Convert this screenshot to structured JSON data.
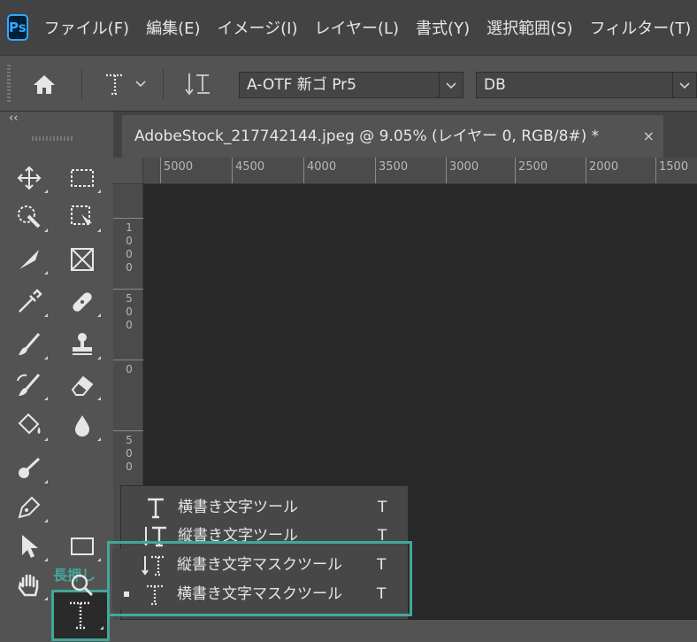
{
  "app": {
    "logo_text": "Ps"
  },
  "menu": [
    "ファイル(F)",
    "編集(E)",
    "イメージ(I)",
    "レイヤー(L)",
    "書式(Y)",
    "選択範囲(S)",
    "フィルター(T)"
  ],
  "options_bar": {
    "font_family": "A-OTF 新ゴ Pr5",
    "font_style": "DB"
  },
  "document_tab": {
    "title": "AdobeStock_217742144.jpeg @ 9.05% (レイヤー 0, RGB/8#) *",
    "close": "×"
  },
  "ruler": {
    "horizontal": [
      "5000",
      "4500",
      "4000",
      "3500",
      "3000",
      "2500",
      "2000",
      "1500"
    ],
    "vertical": [
      {
        "digits": [
          "1",
          "0",
          "0",
          "0"
        ]
      },
      {
        "digits": [
          "5",
          "0",
          "0"
        ]
      },
      {
        "digits": [
          "0"
        ]
      },
      {
        "digits": [
          "5",
          "0",
          "0"
        ]
      }
    ]
  },
  "toolbar": {
    "collapse": "‹‹",
    "longpress_label": "長押し"
  },
  "flyout": {
    "items": [
      {
        "label": "横書き文字ツール",
        "shortcut": "T"
      },
      {
        "label": "縦書き文字ツール",
        "shortcut": "T"
      },
      {
        "label": "縦書き文字マスクツール",
        "shortcut": "T"
      },
      {
        "label": "横書き文字マスクツール",
        "shortcut": "T"
      }
    ]
  },
  "colors": {
    "accent_highlight": "#41a89b",
    "ps_blue": "#31a8ff",
    "canvas": "#282828"
  }
}
